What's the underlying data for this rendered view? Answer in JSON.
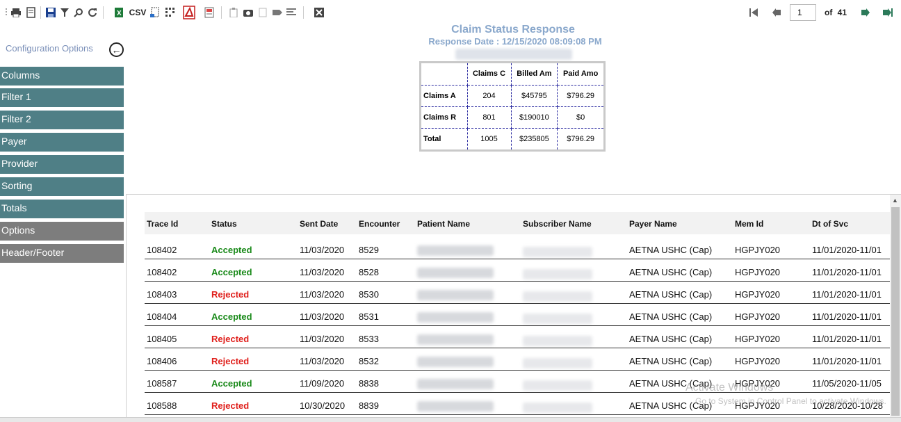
{
  "toolbar": {
    "csv_label": "CSV",
    "page_input_value": "1",
    "page_of_label": "of",
    "page_total": "41"
  },
  "report": {
    "title": "Claim Status Response",
    "response_date": "Response Date : 12/15/2020 08:09:08 PM"
  },
  "summary": {
    "headers": [
      "",
      "Claims C",
      "Billed Am",
      "Paid Amo"
    ],
    "rows": [
      {
        "label": "Claims A",
        "values": [
          "204",
          "$45795",
          "$796.29"
        ]
      },
      {
        "label": "Claims R",
        "values": [
          "801",
          "$190010",
          "$0"
        ]
      },
      {
        "label": "Total",
        "values": [
          "1005",
          "$235805",
          "$796.29"
        ]
      }
    ]
  },
  "sidebar": {
    "config_label": "Configuration Options",
    "items": [
      "Columns",
      "Filter 1",
      "Filter 2",
      "Payer",
      "Provider",
      "Sorting",
      "Totals",
      "Options",
      "Header/Footer"
    ]
  },
  "grid": {
    "headers": [
      "Trace Id",
      "Status",
      "Sent Date",
      "Encounter",
      "Patient Name",
      "Subscriber Name",
      "Payer Name",
      "Mem Id",
      "Dt of Svc"
    ],
    "rows": [
      {
        "trace": "108402",
        "status": "Accepted",
        "sent": "11/03/2020",
        "enc": "8529",
        "payer": "AETNA USHC (Cap)",
        "mem": "HGPJY020",
        "dos": "11/01/2020-11/01"
      },
      {
        "trace": "108402",
        "status": "Accepted",
        "sent": "11/03/2020",
        "enc": "8528",
        "payer": "AETNA USHC (Cap)",
        "mem": "HGPJY020",
        "dos": "11/01/2020-11/01"
      },
      {
        "trace": "108403",
        "status": "Rejected",
        "sent": "11/03/2020",
        "enc": "8530",
        "payer": "AETNA USHC (Cap)",
        "mem": "HGPJY020",
        "dos": "11/01/2020-11/01"
      },
      {
        "trace": "108404",
        "status": "Accepted",
        "sent": "11/03/2020",
        "enc": "8531",
        "payer": "AETNA USHC (Cap)",
        "mem": "HGPJY020",
        "dos": "11/01/2020-11/01"
      },
      {
        "trace": "108405",
        "status": "Rejected",
        "sent": "11/03/2020",
        "enc": "8533",
        "payer": "AETNA USHC (Cap)",
        "mem": "HGPJY020",
        "dos": "11/01/2020-11/01"
      },
      {
        "trace": "108406",
        "status": "Rejected",
        "sent": "11/03/2020",
        "enc": "8532",
        "payer": "AETNA USHC (Cap)",
        "mem": "HGPJY020",
        "dos": "11/01/2020-11/01"
      },
      {
        "trace": "108587",
        "status": "Accepted",
        "sent": "11/09/2020",
        "enc": "8838",
        "payer": "AETNA USHC (Cap)",
        "mem": "HGPJY020",
        "dos": "11/05/2020-11/05"
      },
      {
        "trace": "108588",
        "status": "Rejected",
        "sent": "10/30/2020",
        "enc": "8839",
        "payer": "AETNA USHC (Cap)",
        "mem": "HGPJY020",
        "dos": "10/28/2020-10/28"
      }
    ]
  },
  "watermark": {
    "title": "Activate Windows",
    "subtitle": "Go to System in Control Panel to activate Windows."
  },
  "colors": {
    "sidebar_teal": "#4f7f86",
    "sidebar_gray": "#7d7d7d",
    "accepted": "#1a8a1a",
    "rejected": "#e0201c",
    "title_blue": "#8aa8cc"
  }
}
